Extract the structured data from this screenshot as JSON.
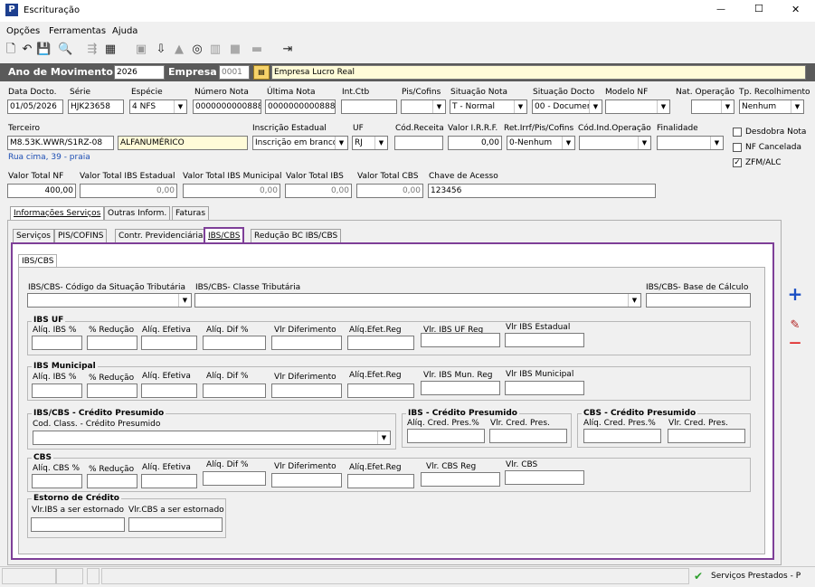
{
  "window": {
    "title": "Escrituração",
    "min": "—",
    "max": "☐",
    "close": "✕"
  },
  "menu": [
    "Opções",
    "Ferramentas",
    "Ajuda"
  ],
  "toolbar": [
    "🗋",
    "↶",
    "💾",
    "🔍",
    "⇶",
    "▦",
    "▣",
    "⇩",
    "▲",
    "◎",
    "▥",
    "■",
    "▬",
    "⇥"
  ],
  "header": {
    "ano_label": "Ano de Movimento",
    "ano_value": "2026",
    "empresa_label": "Empresa",
    "empresa_code": "0001",
    "empresa_name": "Empresa Lucro Real"
  },
  "row1": {
    "data_docto_label": "Data Docto.",
    "data_docto": "01/05/2026",
    "serie_label": "Série",
    "serie": "HJK23658",
    "especie_label": "Espécie",
    "especie": "4 NFS",
    "numero_nota_label": "Número Nota",
    "numero_nota": "0000000000888",
    "ultima_nota_label": "Última Nota",
    "ultima_nota": "0000000000888",
    "int_ctb_label": "Int.Ctb",
    "int_ctb": "",
    "pis_cofins_label": "Pis/Cofins",
    "pis_cofins": "",
    "situacao_nota_label": "Situação Nota",
    "situacao_nota": "T - Normal",
    "situacao_docto_label": "Situação Docto",
    "situacao_docto": "00 - Documer",
    "modelo_nf_label": "Modelo NF",
    "modelo_nf": "",
    "nat_operacao_label": "Nat. Operação",
    "nat_operacao": "",
    "tp_recolhimento_label": "Tp. Recolhimento",
    "tp_recolhimento": "Nenhum"
  },
  "row2": {
    "terceiro_label": "Terceiro",
    "terceiro": "M8.53K.WWR/S1RZ-08",
    "terceiro_tipo": "ALFANUMÉRICO",
    "endereco": "Rua cima, 39 - praia",
    "inscricao_label": "Inscrição Estadual",
    "inscricao": "Inscrição em branco",
    "uf_label": "UF",
    "uf": "RJ",
    "cod_receita_label": "Cód.Receita",
    "cod_receita": "",
    "irrf_label": "Valor I.R.R.F.",
    "irrf": "0,00",
    "ret_irrf_label": "Ret.Irrf/Pis/Cofins",
    "ret_irrf": "0-Nenhum",
    "cod_ind_label": "Cód.Ind.Operação",
    "cod_ind": "",
    "finalidade_label": "Finalidade",
    "finalidade": ""
  },
  "checks": {
    "desdobra": "Desdobra Nota",
    "desdobra_on": false,
    "nf_cancelada": "NF Cancelada",
    "nf_cancelada_on": false,
    "zfm": "ZFM/ALC",
    "zfm_on": true
  },
  "totals": {
    "valor_total_nf_label": "Valor Total NF",
    "valor_total_nf": "400,00",
    "ibs_estadual_label": "Valor Total IBS Estadual",
    "ibs_estadual": "0,00",
    "ibs_municipal_label": "Valor Total IBS Municipal",
    "ibs_municipal": "0,00",
    "ibs_label": "Valor Total IBS",
    "ibs": "0,00",
    "cbs_label": "Valor Total CBS",
    "cbs": "0,00",
    "chave_label": "Chave de Acesso",
    "chave": "123456"
  },
  "tabs1": [
    "Informações Serviços",
    "Outras Inform.",
    "Faturas"
  ],
  "tabs2": [
    "Serviços",
    "PIS/COFINS",
    "Contr. Previdenciária",
    "IBS/CBS",
    "Redução BC IBS/CBS"
  ],
  "inner_tab": "IBS/CBS",
  "ibscbs": {
    "cst_label": "IBS/CBS- Código da Situação Tributária",
    "classe_label": "IBS/CBS- Classe Tributária",
    "base_label": "IBS/CBS- Base de Cálculo"
  },
  "ibs_uf": {
    "title": "IBS UF",
    "labels": [
      "Alíq. IBS %",
      "% Redução",
      "Alíq. Efetiva",
      "Alíq. Dif %",
      "Vlr Diferimento",
      "Alíq.Efet.Reg",
      "Vlr. IBS UF Reg",
      "Vlr IBS Estadual"
    ]
  },
  "ibs_mun": {
    "title": "IBS Municipal",
    "labels": [
      "Alíq. IBS %",
      "% Redução",
      "Alíq. Efetiva",
      "Alíq. Dif %",
      "Vlr Diferimento",
      "Alíq.Efet.Reg",
      "Vlr. IBS Mun. Reg",
      "Vlr IBS Municipal"
    ]
  },
  "credito": {
    "title": "IBS/CBS - Crédito Presumido",
    "cod_label": "Cod. Class. - Crédito Presumido",
    "ibs_title": "IBS - Crédito Presumido",
    "ibs_aliq": "Alíq. Cred. Pres.%",
    "ibs_vlr": "Vlr. Cred. Pres.",
    "cbs_title": "CBS - Crédito Presumido",
    "cbs_aliq": "Alíq. Cred. Pres.%",
    "cbs_vlr": "Vlr. Cred. Pres."
  },
  "cbs": {
    "title": "CBS",
    "labels": [
      "Alíq. CBS %",
      "% Redução",
      "Alíq. Efetiva",
      "Alíq. Dif %",
      "Vlr Diferimento",
      "Alíq.Efet.Reg",
      "Vlr. CBS Reg",
      "Vlr. CBS"
    ]
  },
  "estorno": {
    "title": "Estorno de Crédito",
    "ibs": "Vlr.IBS a ser estornado",
    "cbs": "Vlr.CBS a ser estornado"
  },
  "side": {
    "add": "+",
    "edit": "✎",
    "remove": "—"
  },
  "status": {
    "text": "Serviços Prestados - P",
    "check": "✔"
  },
  "colors": {
    "accent": "#7e3f98",
    "header_bg": "#5a5a5a",
    "plus": "#1a4fc4",
    "minus": "#e02020"
  }
}
